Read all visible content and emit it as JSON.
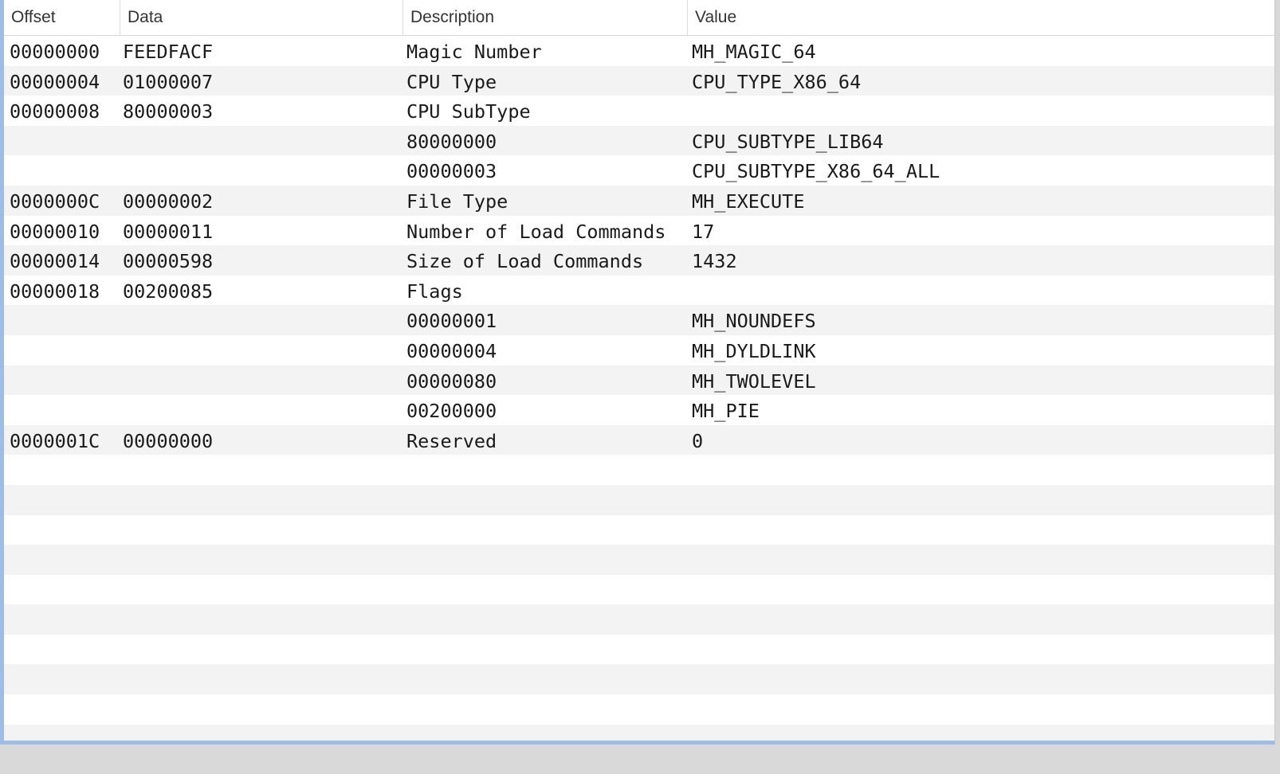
{
  "columns": {
    "offset": "Offset",
    "data": "Data",
    "description": "Description",
    "value": "Value"
  },
  "rows": [
    {
      "offset": "00000000",
      "data": "FEEDFACF",
      "description": "Magic Number",
      "value": "MH_MAGIC_64"
    },
    {
      "offset": "00000004",
      "data": "01000007",
      "description": "CPU Type",
      "value": "CPU_TYPE_X86_64"
    },
    {
      "offset": "00000008",
      "data": "80000003",
      "description": "CPU SubType",
      "value": ""
    },
    {
      "offset": "",
      "data": "",
      "description": "80000000",
      "value": "CPU_SUBTYPE_LIB64"
    },
    {
      "offset": "",
      "data": "",
      "description": "00000003",
      "value": "CPU_SUBTYPE_X86_64_ALL"
    },
    {
      "offset": "0000000C",
      "data": "00000002",
      "description": "File Type",
      "value": "MH_EXECUTE"
    },
    {
      "offset": "00000010",
      "data": "00000011",
      "description": "Number of Load Commands",
      "value": "17"
    },
    {
      "offset": "00000014",
      "data": "00000598",
      "description": "Size of Load Commands",
      "value": "1432"
    },
    {
      "offset": "00000018",
      "data": "00200085",
      "description": "Flags",
      "value": ""
    },
    {
      "offset": "",
      "data": "",
      "description": "00000001",
      "value": "MH_NOUNDEFS"
    },
    {
      "offset": "",
      "data": "",
      "description": "00000004",
      "value": "MH_DYLDLINK"
    },
    {
      "offset": "",
      "data": "",
      "description": "00000080",
      "value": "MH_TWOLEVEL"
    },
    {
      "offset": "",
      "data": "",
      "description": "00200000",
      "value": "MH_PIE"
    },
    {
      "offset": "0000001C",
      "data": "00000000",
      "description": "Reserved",
      "value": "0"
    },
    {
      "offset": "",
      "data": "",
      "description": "",
      "value": ""
    },
    {
      "offset": "",
      "data": "",
      "description": "",
      "value": ""
    },
    {
      "offset": "",
      "data": "",
      "description": "",
      "value": ""
    },
    {
      "offset": "",
      "data": "",
      "description": "",
      "value": ""
    },
    {
      "offset": "",
      "data": "",
      "description": "",
      "value": ""
    },
    {
      "offset": "",
      "data": "",
      "description": "",
      "value": ""
    },
    {
      "offset": "",
      "data": "",
      "description": "",
      "value": ""
    },
    {
      "offset": "",
      "data": "",
      "description": "",
      "value": ""
    },
    {
      "offset": "",
      "data": "",
      "description": "",
      "value": ""
    },
    {
      "offset": "",
      "data": "",
      "description": "",
      "value": ""
    }
  ],
  "colors": {
    "selection_border": "#9cbde6",
    "stripe": "#f3f3f3",
    "footer": "#d9d9d9"
  }
}
